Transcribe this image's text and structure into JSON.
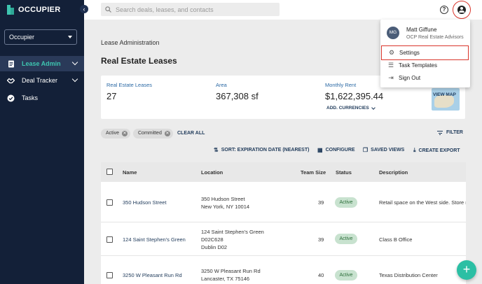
{
  "app": {
    "logo_text": "OCCUPIER"
  },
  "sidebar": {
    "org_select": "Occupier",
    "items": [
      {
        "label": "Lease Admin",
        "icon": "document-icon",
        "active": true
      },
      {
        "label": "Deal Tracker",
        "icon": "handshake-icon",
        "active": false
      },
      {
        "label": "Tasks",
        "icon": "check-circle-icon",
        "active": false
      }
    ]
  },
  "topbar": {
    "search_placeholder": "Search deals, leases, and contacts"
  },
  "page": {
    "breadcrumb": "Lease Administration",
    "title": "Real Estate Leases"
  },
  "stats": {
    "leases_label": "Real Estate Leases",
    "leases_value": "27",
    "area_label": "Area",
    "area_value": "367,308 sf",
    "rent_label": "Monthly Rent",
    "rent_value": "$1,622,395.44",
    "add_currencies": "ADD. CURRENCIES",
    "view_map": "VIEW MAP"
  },
  "filters": {
    "chips": [
      "Active",
      "Committed"
    ],
    "clear_all": "CLEAR ALL",
    "filter_label": "FILTER"
  },
  "toolbar": {
    "sort": "SORT: EXPIRATION DATE (NEAREST)",
    "configure": "CONFIGURE",
    "saved_views": "SAVED VIEWS",
    "create_export": "CREATE EXPORT"
  },
  "table": {
    "headers": {
      "name": "Name",
      "location": "Location",
      "team_size": "Team Size",
      "status": "Status",
      "description": "Description"
    },
    "rows": [
      {
        "name": "350 Hudson Street",
        "loc1": "350 Hudson Street",
        "loc2": "New York, NY 10014",
        "loc3": "",
        "team": "39",
        "status": "Active",
        "description": "Retail space on the West side. Store n"
      },
      {
        "name": "124 Saint Stephen's Green",
        "loc1": "124 Saint Stephen's Green",
        "loc2": "D02C628",
        "loc3": "Dublin D02",
        "team": "39",
        "status": "Active",
        "description": "Class B Office"
      },
      {
        "name": "3250 W Pleasant Run Rd",
        "loc1": "3250 W Pleasant Run Rd",
        "loc2": "Lancaster, TX 75146",
        "loc3": "",
        "team": "40",
        "status": "Active",
        "description": "Texas Distribution Center"
      }
    ]
  },
  "user_menu": {
    "initials": "MG",
    "name": "Matt Giffune",
    "org": "OCP Real Estate Advisors",
    "items": [
      {
        "label": "Settings",
        "icon": "gear-icon"
      },
      {
        "label": "Task Templates",
        "icon": "list-check-icon"
      },
      {
        "label": "Sign Out",
        "icon": "sign-out-icon"
      }
    ]
  },
  "colors": {
    "sidebar_bg": "#132038",
    "accent": "#3ec5b0",
    "highlight_ring": "#d9352b",
    "fab": "#2bbfa4"
  }
}
